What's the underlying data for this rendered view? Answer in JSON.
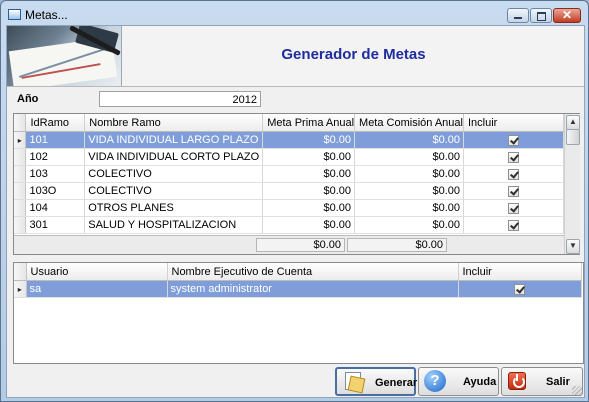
{
  "window": {
    "title": "Metas...",
    "controls": {
      "minimize": "minimize",
      "maximize": "maximize",
      "close": "✕"
    }
  },
  "header": {
    "title": "Generador de Metas"
  },
  "year": {
    "label": "Año",
    "value": "2012"
  },
  "goals_grid": {
    "columns": [
      "IdRamo",
      "Nombre Ramo",
      "Meta Prima Anual",
      "Meta Comisión Anual",
      "Incluir"
    ],
    "rows": [
      {
        "id": "101",
        "name": "VIDA INDIVIDUAL LARGO PLAZO",
        "prima": "$0.00",
        "comision": "$0.00",
        "incluir": true,
        "selected": true
      },
      {
        "id": "102",
        "name": "VIDA INDIVIDUAL CORTO PLAZO",
        "prima": "$0.00",
        "comision": "$0.00",
        "incluir": true,
        "selected": false
      },
      {
        "id": "103",
        "name": "COLECTIVO",
        "prima": "$0.00",
        "comision": "$0.00",
        "incluir": true,
        "selected": false
      },
      {
        "id": "103O",
        "name": "COLECTIVO",
        "prima": "$0.00",
        "comision": "$0.00",
        "incluir": true,
        "selected": false
      },
      {
        "id": "104",
        "name": "OTROS PLANES",
        "prima": "$0.00",
        "comision": "$0.00",
        "incluir": true,
        "selected": false
      },
      {
        "id": "301",
        "name": "SALUD Y HOSPITALIZACION",
        "prima": "$0.00",
        "comision": "$0.00",
        "incluir": true,
        "selected": false
      }
    ],
    "totals": {
      "prima": "$0.00",
      "comision": "$0.00"
    }
  },
  "users_grid": {
    "columns": [
      "Usuario",
      "Nombre Ejecutivo de Cuenta",
      "Incluir"
    ],
    "rows": [
      {
        "user": "sa",
        "name": "system administrator",
        "incluir": true,
        "selected": true
      }
    ]
  },
  "buttons": {
    "generate": "Generar",
    "help": "Ayuda",
    "exit": "Salir"
  },
  "colors": {
    "title_text": "#1f2c9c",
    "selection": "#7f9ed9",
    "window_frame": "#b4cbe4"
  },
  "icons": {
    "row_indicator": "▸",
    "scroll_up": "▲",
    "scroll_down": "▼",
    "help_glyph": "?"
  }
}
